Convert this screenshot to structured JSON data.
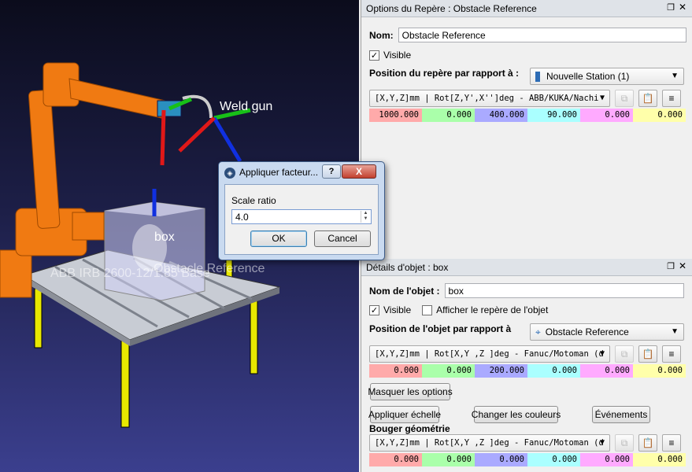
{
  "viewport": {
    "tool_label": "Weld gun",
    "object_label": "box",
    "frame_label": "Obstacle Reference",
    "robot_label": "ABB IRB 2600-12/1.85 Base"
  },
  "frame_panel": {
    "title": "Options du Repère : Obstacle Reference",
    "name_label": "Nom:",
    "name_value": "Obstacle Reference",
    "visible_label": "Visible",
    "visible_checked": true,
    "position_label": "Position du repère par rapport à :",
    "reference_value": "Nouvelle Station (1)",
    "format_value": "[X,Y,Z]mm | Rot[Z,Y',X'']deg - ABB/KUKA/Nachi",
    "values": [
      "1000.000",
      "0.000",
      "400.000",
      "90.000",
      "0.000",
      "0.000"
    ]
  },
  "object_panel": {
    "title": "Détails d'objet : box",
    "name_label": "Nom de l'objet :",
    "name_value": "box",
    "visible_label": "Visible",
    "visible_checked": true,
    "show_frame_label": "Afficher le repère de l'objet",
    "show_frame_checked": false,
    "position_label": "Position de l'objet par rapport à",
    "reference_value": "Obstacle Reference",
    "format_value": "[X,Y,Z]mm | Rot[X,Y ,Z  ]deg - Fanuc/Motoman (d",
    "values": [
      "0.000",
      "0.000",
      "200.000",
      "0.000",
      "0.000",
      "0.000"
    ],
    "hide_options_label": "Masquer les options",
    "apply_scale_label": "Appliquer échelle",
    "change_colors_label": "Changer les couleurs",
    "events_label": "Événements",
    "move_geometry_label": "Bouger géométrie",
    "geo_format_value": "[X,Y,Z]mm | Rot[X,Y ,Z  ]deg - Fanuc/Motoman (d",
    "geo_values": [
      "0.000",
      "0.000",
      "0.000",
      "0.000",
      "0.000",
      "0.000"
    ]
  },
  "dialog": {
    "title": "Appliquer facteur...",
    "help_label": "?",
    "close_label": "X",
    "field_label": "Scale ratio",
    "field_value": "4.0",
    "ok_label": "OK",
    "cancel_label": "Cancel"
  },
  "colors": {
    "x": "#ffaaaa",
    "y": "#aaffaa",
    "z": "#aaaaff",
    "rx": "#aaffff",
    "ry": "#ffaaff",
    "rz": "#ffffaa",
    "robot": "#f07a12"
  }
}
